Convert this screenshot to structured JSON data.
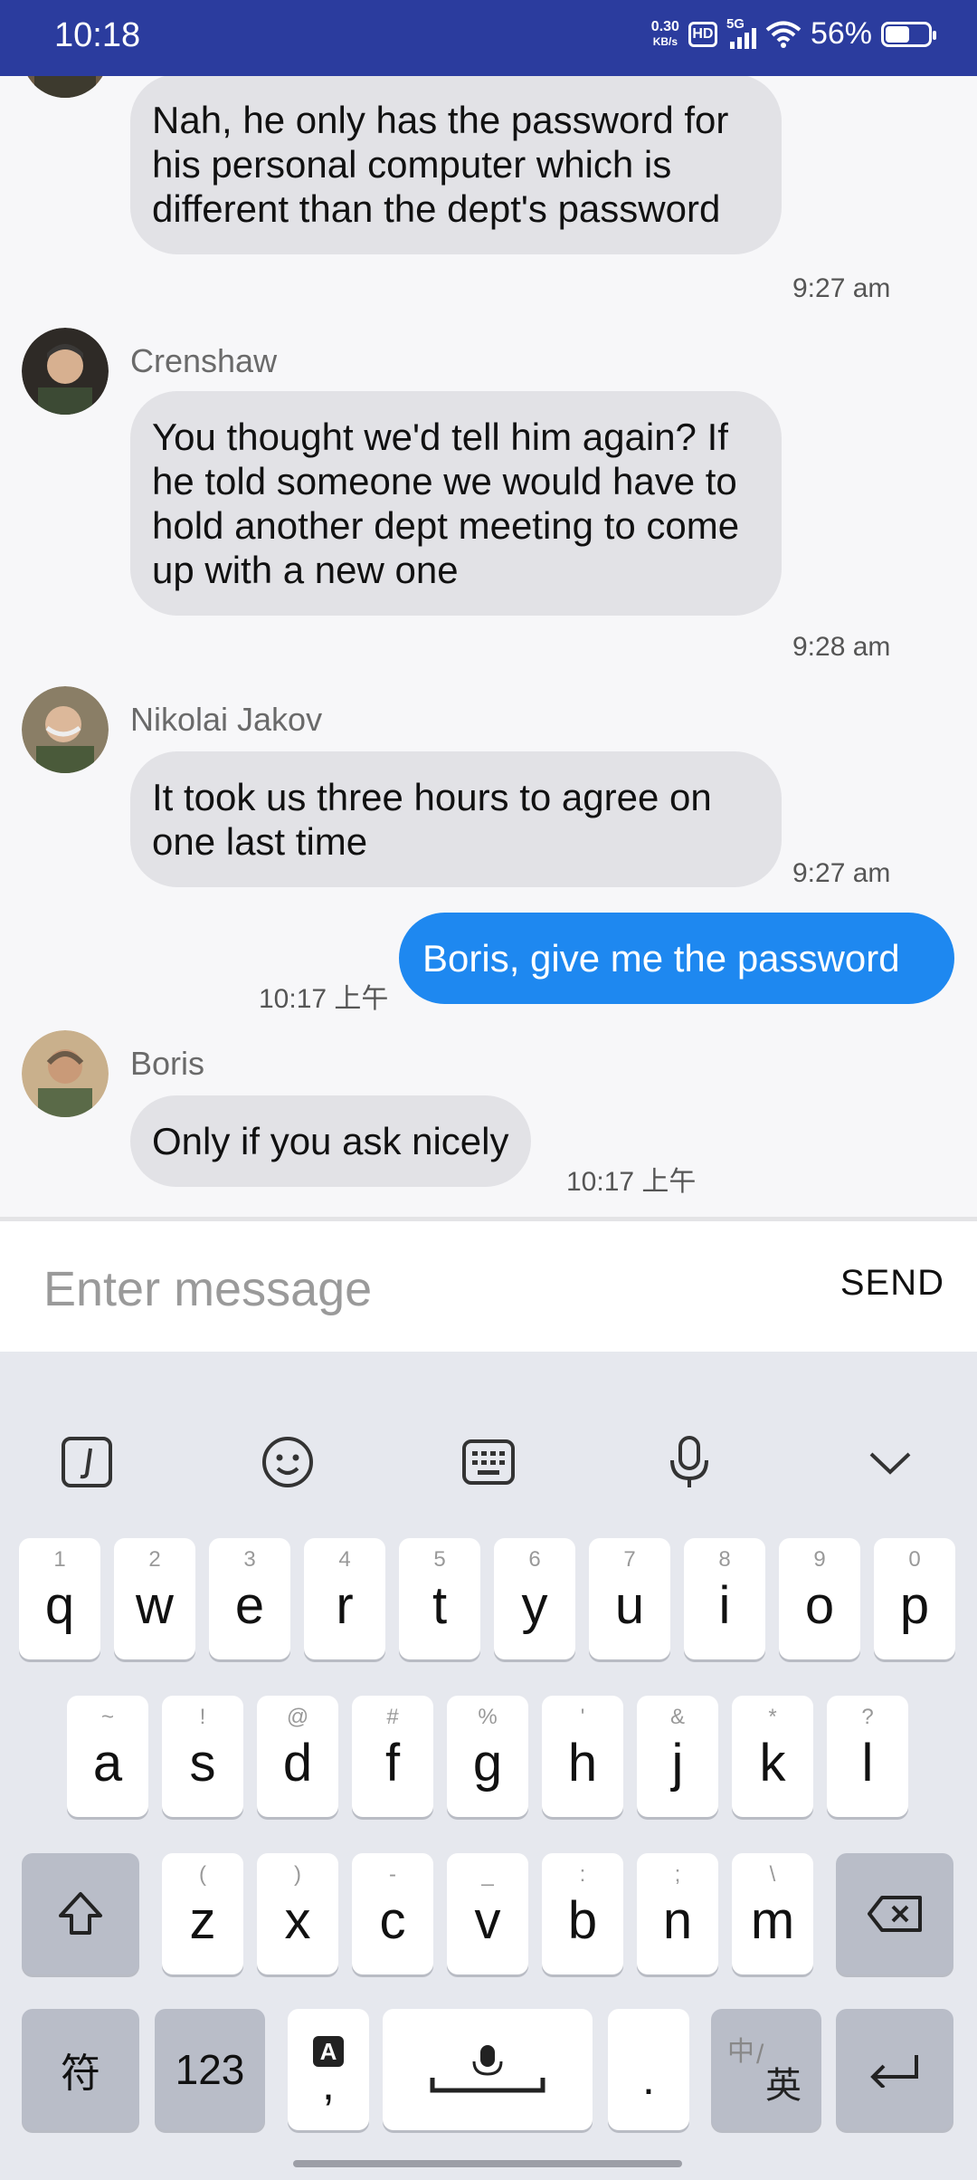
{
  "status": {
    "time": "10:18",
    "net_speed_value": "0.30",
    "net_speed_unit": "KB/s",
    "hd": "HD",
    "network": "5G",
    "battery_text": "56%",
    "battery_level": 0.56
  },
  "messages": [
    {
      "sender": "",
      "text": "Nah, he only has the password for his personal computer which is different than the dept's password",
      "time": "9:27 am"
    },
    {
      "sender": "Crenshaw",
      "text": "You thought we'd tell him again? If he told someone we would have to hold another dept meeting to come up with a new one",
      "time": "9:28 am"
    },
    {
      "sender": "Nikolai Jakov",
      "text": "It took us three hours to agree on one last time",
      "time": "9:27 am"
    },
    {
      "sender": "",
      "text": "Boris, give me the password",
      "time": "10:17 上午"
    },
    {
      "sender": "Boris",
      "text": "Only if you ask nicely",
      "time": "10:17 上午"
    }
  ],
  "composer": {
    "placeholder": "Enter message",
    "send_label": "SEND"
  },
  "keyboard": {
    "row1": [
      {
        "k": "q",
        "s": "1"
      },
      {
        "k": "w",
        "s": "2"
      },
      {
        "k": "e",
        "s": "3"
      },
      {
        "k": "r",
        "s": "4"
      },
      {
        "k": "t",
        "s": "5"
      },
      {
        "k": "y",
        "s": "6"
      },
      {
        "k": "u",
        "s": "7"
      },
      {
        "k": "i",
        "s": "8"
      },
      {
        "k": "o",
        "s": "9"
      },
      {
        "k": "p",
        "s": "0"
      }
    ],
    "row2": [
      {
        "k": "a",
        "s": "~"
      },
      {
        "k": "s",
        "s": "!"
      },
      {
        "k": "d",
        "s": "@"
      },
      {
        "k": "f",
        "s": "#"
      },
      {
        "k": "g",
        "s": "%"
      },
      {
        "k": "h",
        "s": "'"
      },
      {
        "k": "j",
        "s": "&"
      },
      {
        "k": "k",
        "s": "*"
      },
      {
        "k": "l",
        "s": "?"
      }
    ],
    "row3": [
      {
        "k": "z",
        "s": "("
      },
      {
        "k": "x",
        "s": ")"
      },
      {
        "k": "c",
        "s": "-"
      },
      {
        "k": "v",
        "s": "_"
      },
      {
        "k": "b",
        "s": ":"
      },
      {
        "k": "n",
        "s": ";"
      },
      {
        "k": "m",
        "s": "\\"
      }
    ],
    "symbols_label": "符",
    "numbers_label": "123",
    "comma_badge": "A",
    "comma": ",",
    "period": ".",
    "lang_zh": "中",
    "lang_en": "英"
  }
}
